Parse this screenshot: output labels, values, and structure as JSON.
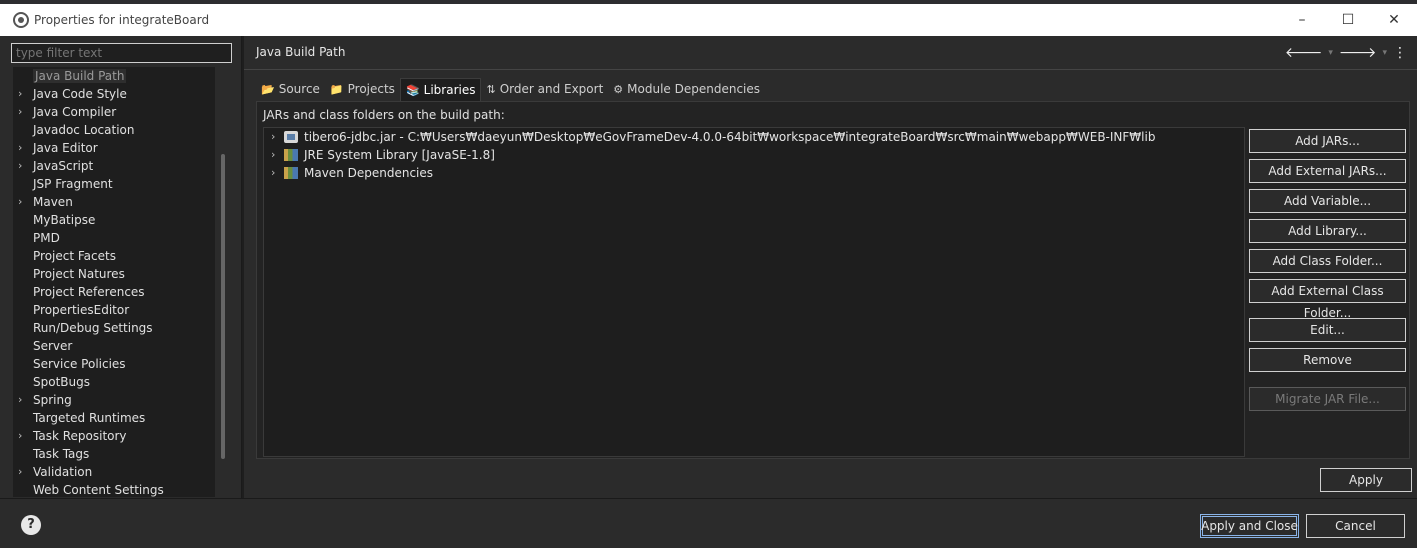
{
  "window": {
    "title": "Properties for integrateBoard",
    "controls": {
      "minimize": "–",
      "maximize": "☐",
      "close": "✕"
    }
  },
  "filter": {
    "placeholder": "type filter text",
    "value": ""
  },
  "nav_tree": {
    "items": [
      {
        "label": "Java Build Path",
        "expandable": false,
        "selected": true
      },
      {
        "label": "Java Code Style",
        "expandable": true
      },
      {
        "label": "Java Compiler",
        "expandable": true
      },
      {
        "label": "Javadoc Location",
        "expandable": false
      },
      {
        "label": "Java Editor",
        "expandable": true
      },
      {
        "label": "JavaScript",
        "expandable": true
      },
      {
        "label": "JSP Fragment",
        "expandable": false
      },
      {
        "label": "Maven",
        "expandable": true
      },
      {
        "label": "MyBatipse",
        "expandable": false
      },
      {
        "label": "PMD",
        "expandable": false
      },
      {
        "label": "Project Facets",
        "expandable": false
      },
      {
        "label": "Project Natures",
        "expandable": false
      },
      {
        "label": "Project References",
        "expandable": false
      },
      {
        "label": "PropertiesEditor",
        "expandable": false
      },
      {
        "label": "Run/Debug Settings",
        "expandable": false
      },
      {
        "label": "Server",
        "expandable": false
      },
      {
        "label": "Service Policies",
        "expandable": false
      },
      {
        "label": "SpotBugs",
        "expandable": false
      },
      {
        "label": "Spring",
        "expandable": true
      },
      {
        "label": "Targeted Runtimes",
        "expandable": false
      },
      {
        "label": "Task Repository",
        "expandable": true
      },
      {
        "label": "Task Tags",
        "expandable": false
      },
      {
        "label": "Validation",
        "expandable": true
      },
      {
        "label": "Web Content Settings",
        "expandable": false
      }
    ]
  },
  "page": {
    "title": "Java Build Path",
    "nav": {
      "back": "🡐",
      "forward": "🡒",
      "menu": "⋮"
    }
  },
  "tabs": [
    {
      "label": "Source",
      "icon": "source-folder-icon",
      "active": false
    },
    {
      "label": "Projects",
      "icon": "projects-icon",
      "active": false
    },
    {
      "label": "Libraries",
      "icon": "libraries-icon",
      "active": true
    },
    {
      "label": "Order and Export",
      "icon": "order-export-icon",
      "active": false
    },
    {
      "label": "Module Dependencies",
      "icon": "module-icon",
      "active": false
    }
  ],
  "libraries": {
    "description": "JARs and class folders on the build path:",
    "entries": [
      {
        "label": "tibero6-jdbc.jar - C:₩Users₩daeyun₩Desktop₩eGovFrameDev-4.0.0-64bit₩workspace₩integrateBoard₩src₩main₩webapp₩WEB-INF₩lib",
        "icon": "jar-icon"
      },
      {
        "label": "JRE System Library [JavaSE-1.8]",
        "icon": "library-icon"
      },
      {
        "label": "Maven Dependencies",
        "icon": "library-icon"
      }
    ],
    "buttons": [
      {
        "label": "Add JARs...",
        "enabled": true
      },
      {
        "label": "Add External JARs...",
        "enabled": true
      },
      {
        "label": "Add Variable...",
        "enabled": true
      },
      {
        "label": "Add Library...",
        "enabled": true
      },
      {
        "label": "Add Class Folder...",
        "enabled": true
      },
      {
        "label": "Add External Class Folder...",
        "enabled": true
      },
      {
        "label": "Edit...",
        "enabled": true
      },
      {
        "label": "Remove",
        "enabled": true
      },
      {
        "label": "Migrate JAR File...",
        "enabled": false
      }
    ]
  },
  "actions": {
    "apply": "Apply",
    "apply_and_close": "Apply and Close",
    "cancel": "Cancel",
    "help": "?"
  }
}
